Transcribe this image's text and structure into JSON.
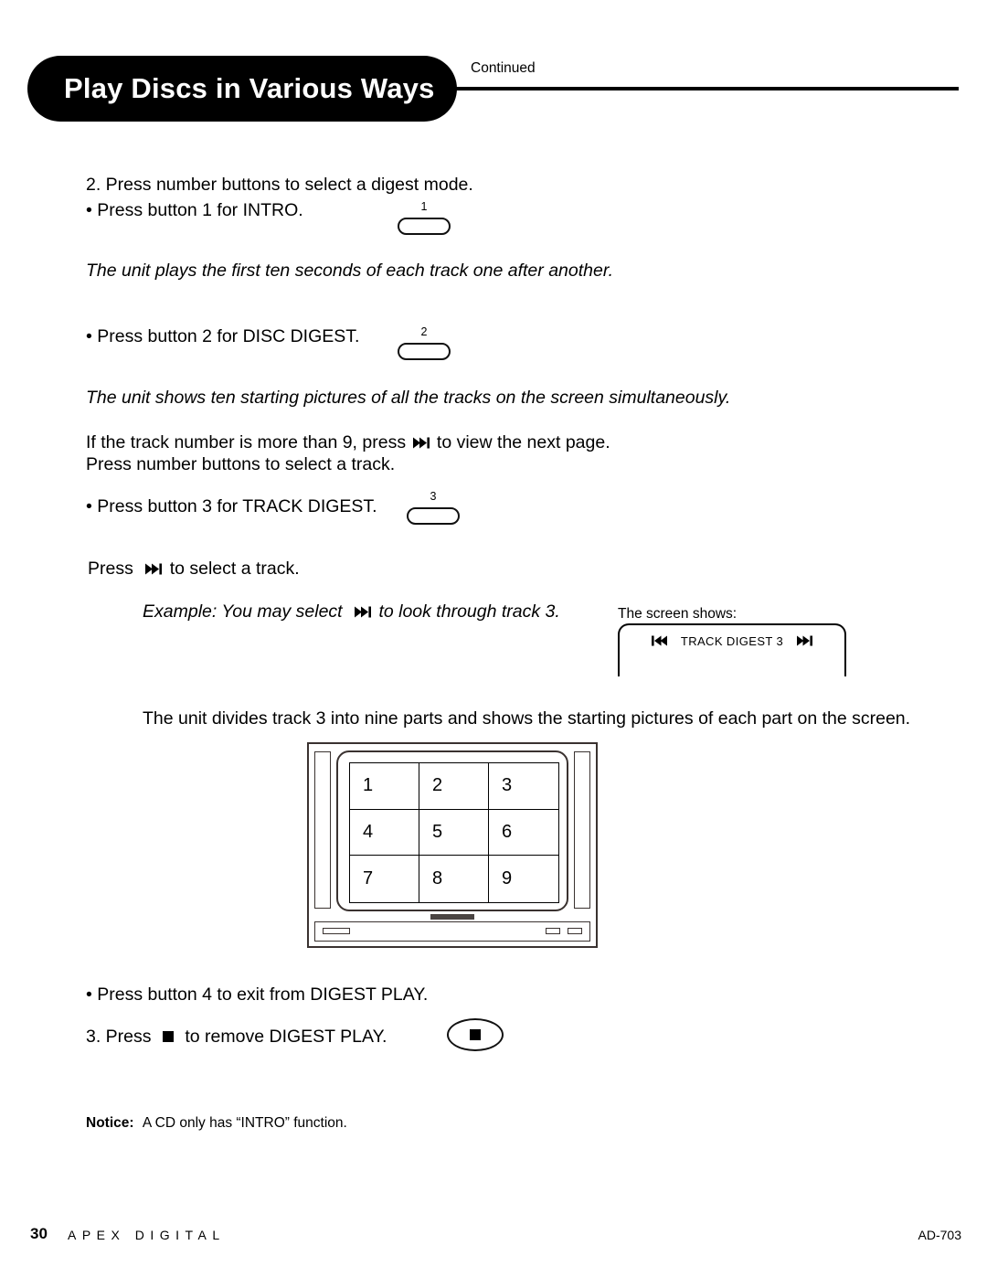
{
  "page": {
    "header_title": "Play Discs in Various Ways",
    "continued_label": "Continued"
  },
  "icons": {
    "next_track": "next-track-icon",
    "prev_track": "prev-track-icon",
    "stop": "stop-icon"
  },
  "steps": {
    "step2_line": "2. Press number buttons to select a digest mode.",
    "bullet_intro": "• Press button 1 for INTRO.",
    "intro_result": "The unit plays the first ten seconds of each track one after another.",
    "bullet_disc_digest": "• Press button 2 for DISC DIGEST.",
    "disc_digest_result": "The unit shows ten starting pictures of all the tracks on the screen simultaneously.",
    "more_than_9_pre": "If the track number is more than 9, press",
    "more_than_9_post": "to view the next page.",
    "select_track_line": "Press number buttons to select a track.",
    "bullet_track_digest": "• Press button 3 for TRACK DIGEST.",
    "press_to_select_pre": "Press",
    "press_to_select_post": "to select a track.",
    "example_pre": "Example:  You may select",
    "example_post": "to look through track 3.",
    "screen_shows_label": "The screen shows:",
    "divides_line": "The unit divides track 3 into nine parts and shows the starting pictures of each part on the screen.",
    "bullet_exit": "• Press button 4 to exit from DIGEST PLAY.",
    "step3_pre": "3. Press",
    "step3_post": "to remove DIGEST PLAY."
  },
  "buttons": {
    "btn1_label": "1",
    "btn2_label": "2",
    "btn3_label": "3"
  },
  "osd": {
    "text": "TRACK DIGEST 3"
  },
  "tv_screen": {
    "cells": [
      "1",
      "2",
      "3",
      "4",
      "5",
      "6",
      "7",
      "8",
      "9"
    ]
  },
  "notice": {
    "label": "Notice:",
    "text": "A CD only has “INTRO” function."
  },
  "footer": {
    "page_number": "30",
    "brand": "APEX DIGITAL",
    "model": "AD-703"
  }
}
